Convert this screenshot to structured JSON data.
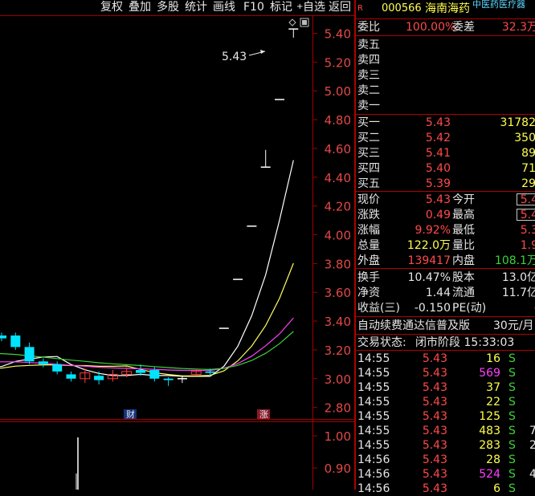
{
  "toolbar": {
    "items": [
      "复权",
      "叠加",
      "多股",
      "统计",
      "画线",
      "F10",
      "标记",
      "+",
      "自选",
      "返回"
    ]
  },
  "chart": {
    "price_ticks": [
      "5.40",
      "5.20",
      "5.00",
      "4.80",
      "4.60",
      "4.40",
      "4.20",
      "4.00",
      "3.80",
      "3.60",
      "3.40",
      "3.20",
      "3.00",
      "2.80"
    ],
    "volume_ticks": [
      "1.00",
      "0.90"
    ],
    "high_label": "5.43",
    "markers": [
      "财",
      "涨"
    ],
    "colors": {
      "up": "#ff3c3c",
      "down": "#00e4ff",
      "ma5": "#ffffff",
      "ma10": "#ffff60",
      "ma20": "#ff40ff",
      "ma60": "#3cd23c",
      "grid": "#a00000"
    }
  },
  "chart_data": {
    "type": "candlestick",
    "y_range": [
      2.72,
      5.52
    ],
    "candles": [
      {
        "o": 3.3,
        "c": 3.28,
        "h": 3.32,
        "l": 3.26
      },
      {
        "o": 3.3,
        "c": 3.22,
        "h": 3.32,
        "l": 3.2
      },
      {
        "o": 3.22,
        "c": 3.12,
        "h": 3.25,
        "l": 3.1
      },
      {
        "o": 3.12,
        "c": 3.1,
        "h": 3.14,
        "l": 3.08
      },
      {
        "o": 3.1,
        "c": 3.05,
        "h": 3.12,
        "l": 3.03
      },
      {
        "o": 3.03,
        "c": 3.0,
        "h": 3.05,
        "l": 2.98
      },
      {
        "o": 3.0,
        "c": 3.04,
        "h": 3.07,
        "l": 2.97
      },
      {
        "o": 3.02,
        "c": 2.99,
        "h": 3.05,
        "l": 2.96
      },
      {
        "o": 3.0,
        "c": 3.03,
        "h": 3.06,
        "l": 2.98
      },
      {
        "o": 3.03,
        "c": 3.05,
        "h": 3.08,
        "l": 3.01
      },
      {
        "o": 3.06,
        "c": 3.04,
        "h": 3.1,
        "l": 3.02
      },
      {
        "o": 3.06,
        "c": 3.0,
        "h": 3.08,
        "l": 2.98
      },
      {
        "o": 3.0,
        "c": 2.99,
        "h": 3.01,
        "l": 2.95
      },
      {
        "o": 3.0,
        "c": 3.0,
        "h": 3.02,
        "l": 2.97
      },
      {
        "o": 3.03,
        "c": 3.05,
        "h": 3.07,
        "l": 3.02
      },
      {
        "o": 3.05,
        "c": 3.04,
        "h": 3.07,
        "l": 3.02
      },
      {
        "o": 3.35,
        "c": 3.35,
        "h": 3.35,
        "l": 3.35
      },
      {
        "o": 3.69,
        "c": 3.69,
        "h": 3.69,
        "l": 3.69
      },
      {
        "o": 4.06,
        "c": 4.06,
        "h": 4.06,
        "l": 4.06
      },
      {
        "o": 4.47,
        "c": 4.47,
        "h": 4.59,
        "l": 4.47
      },
      {
        "o": 4.94,
        "c": 4.94,
        "h": 4.94,
        "l": 4.94
      },
      {
        "o": 5.43,
        "c": 5.43,
        "h": 5.43,
        "l": 5.37
      }
    ]
  },
  "stock": {
    "badge": "R",
    "code": "000566",
    "name": "海南海药",
    "sector": "中医药医疗器",
    "weibi_label": "委比",
    "weibi_value": "100.00%",
    "weicha_label": "委差",
    "weicha_value": "32.3万"
  },
  "sell_book": [
    "卖五",
    "卖四",
    "卖三",
    "卖二",
    "卖一"
  ],
  "buy_book": [
    {
      "label": "买一",
      "price": "5.43",
      "vol": "31782"
    },
    {
      "label": "买二",
      "price": "5.42",
      "vol": "350"
    },
    {
      "label": "买三",
      "price": "5.41",
      "vol": "89"
    },
    {
      "label": "买四",
      "price": "5.40",
      "vol": "71"
    },
    {
      "label": "买五",
      "price": "5.39",
      "vol": "29"
    }
  ],
  "quote": [
    {
      "l": "现价",
      "v": "5.43",
      "vc": "red",
      "l2": "今开",
      "v2": "5.4",
      "v2c": "red",
      "box": true
    },
    {
      "l": "涨跌",
      "v": "0.49",
      "vc": "red",
      "l2": "最高",
      "v2": "5.4",
      "v2c": "red",
      "box": true
    },
    {
      "l": "涨幅",
      "v": "9.92%",
      "vc": "red",
      "l2": "最低",
      "v2": "5.3",
      "v2c": "red",
      "box": false
    },
    {
      "l": "总量",
      "v": "122.0万",
      "vc": "yellow",
      "l2": "量比",
      "v2": "1.9",
      "v2c": "red",
      "box": false
    },
    {
      "l": "外盘",
      "v": "139417",
      "vc": "red",
      "l2": "内盘",
      "v2": "108.1万",
      "v2c": "green",
      "box": false
    }
  ],
  "quote2": [
    {
      "l": "换手",
      "v": "10.47%",
      "vc": "white",
      "l2": "股本",
      "v2": "13.0亿",
      "v2c": "white"
    },
    {
      "l": "净资",
      "v": "1.44",
      "vc": "white",
      "l2": "流通",
      "v2": "11.7亿",
      "v2c": "white"
    },
    {
      "l": "收益(三)",
      "v": "-0.150",
      "vc": "white",
      "l2": "PE(动)",
      "v2": "-",
      "v2c": "white"
    }
  ],
  "promo": {
    "text": "自动续费通达信普及版",
    "price": "30元/月"
  },
  "status": {
    "label": "交易状态:",
    "value": "闭市阶段 15:33:03"
  },
  "ticks": [
    {
      "t": "14:55",
      "p": "5.43",
      "v": "16",
      "vc": "yellow",
      "s": "S",
      "x": ""
    },
    {
      "t": "14:55",
      "p": "5.43",
      "v": "569",
      "vc": "mag",
      "s": "S",
      "x": ""
    },
    {
      "t": "14:55",
      "p": "5.43",
      "v": "37",
      "vc": "yellow",
      "s": "S",
      "x": ""
    },
    {
      "t": "14:55",
      "p": "5.43",
      "v": "22",
      "vc": "yellow",
      "s": "S",
      "x": ""
    },
    {
      "t": "14:55",
      "p": "5.43",
      "v": "125",
      "vc": "yellow",
      "s": "S",
      "x": ""
    },
    {
      "t": "14:55",
      "p": "5.43",
      "v": "483",
      "vc": "yellow",
      "s": "S",
      "x": "7"
    },
    {
      "t": "14:55",
      "p": "5.43",
      "v": "283",
      "vc": "yellow",
      "s": "S",
      "x": "2"
    },
    {
      "t": "14:56",
      "p": "5.43",
      "v": "28",
      "vc": "yellow",
      "s": "S",
      "x": ""
    },
    {
      "t": "14:56",
      "p": "5.43",
      "v": "524",
      "vc": "mag",
      "s": "S",
      "x": "4"
    },
    {
      "t": "14:56",
      "p": "5.43",
      "v": "6",
      "vc": "yellow",
      "s": "S",
      "x": ""
    }
  ]
}
